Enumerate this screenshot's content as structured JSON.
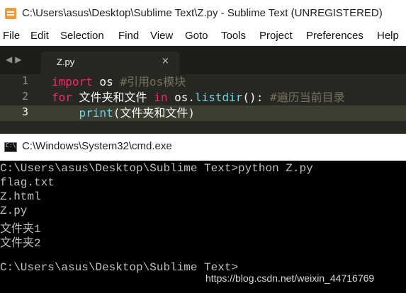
{
  "sublime": {
    "title": "C:\\Users\\asus\\Desktop\\Sublime Text\\Z.py - Sublime Text (UNREGISTERED)",
    "menu": [
      "File",
      "Edit",
      "Selection",
      "Find",
      "View",
      "Goto",
      "Tools",
      "Project",
      "Preferences",
      "Help"
    ],
    "tab": {
      "label": "Z.py",
      "close": "×"
    },
    "gutter": [
      "1",
      "2",
      "3"
    ],
    "code": {
      "line1": {
        "kw": "import",
        "mod": " os ",
        "comment": "#引用os模块"
      },
      "line2": {
        "kw": "for",
        "var": " 文件夹和文件 ",
        "in": "in",
        "obj": " os.",
        "fn": "listdir",
        "paren": "(): ",
        "comment": "#遍历当前目录"
      },
      "line3": {
        "indent": "    ",
        "fn": "print",
        "args": "(文件夹和文件)"
      }
    },
    "accent_colors": {
      "keyword": "#f92672",
      "function": "#66d9ef",
      "comment": "#75715e",
      "background": "#272822"
    }
  },
  "cmd": {
    "title": "C:\\Windows\\System32\\cmd.exe",
    "lines": [
      "C:\\Users\\asus\\Desktop\\Sublime Text>python Z.py",
      "flag.txt",
      "Z.html",
      "Z.py",
      "文件夹1",
      "文件夹2",
      "",
      "C:\\Users\\asus\\Desktop\\Sublime Text>"
    ]
  },
  "watermark": "https://blog.csdn.net/weixin_44716769"
}
